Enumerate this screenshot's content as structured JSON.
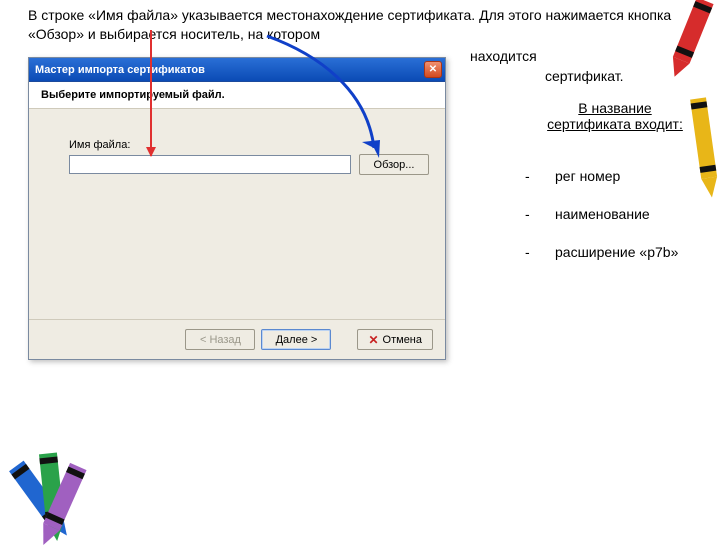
{
  "intro": {
    "para": "В строке «Имя файла» указывается местонахождение сертификата. Для этого нажимается кнопка «Обзор» и выбирается носитель, на котором",
    "line3": "находится",
    "line4": "сертификат."
  },
  "subtitle": "В название сертификата входит:",
  "bullets": [
    "рег номер",
    "наименование",
    "расширение «p7b»"
  ],
  "dialog": {
    "title": "Мастер импорта сертификатов",
    "subhead": "Выберите импортируемый файл.",
    "field_label": "Имя файла:",
    "field_value": "",
    "browse": "Обзор...",
    "back": "< Назад",
    "next": "Далее >",
    "cancel": "Отмена"
  }
}
